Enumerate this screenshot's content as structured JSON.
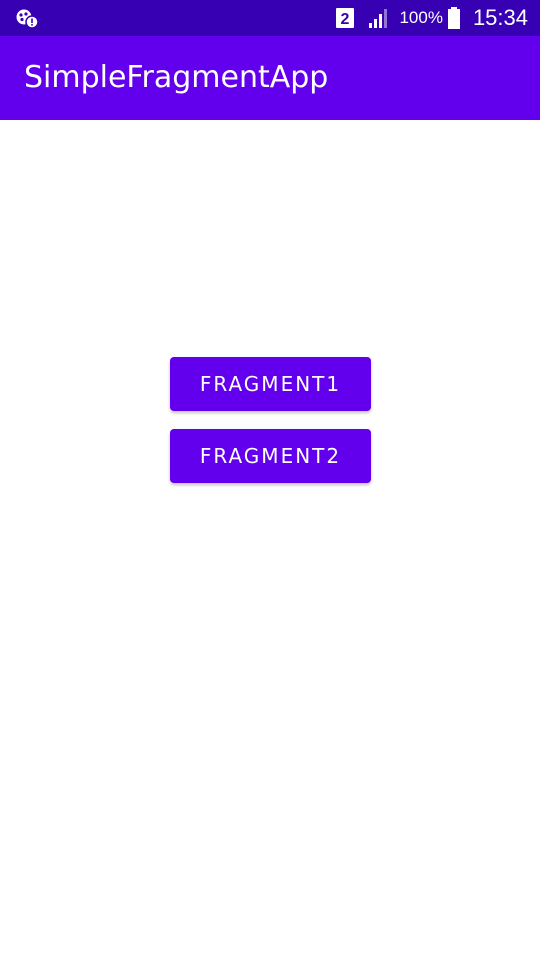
{
  "status_bar": {
    "sim_slot": "2",
    "battery_percent": "100%",
    "time": "15:34",
    "icons": [
      "notification-alert-icon",
      "sim-2-icon",
      "signal-icon",
      "battery-icon"
    ]
  },
  "app_bar": {
    "title": "SimpleFragmentApp"
  },
  "buttons": {
    "fragment1_label": "FRAGMENT1",
    "fragment2_label": "FRAGMENT2"
  },
  "colors": {
    "status_bar": "#3700b3",
    "primary": "#6200ee",
    "background": "#ffffff"
  }
}
